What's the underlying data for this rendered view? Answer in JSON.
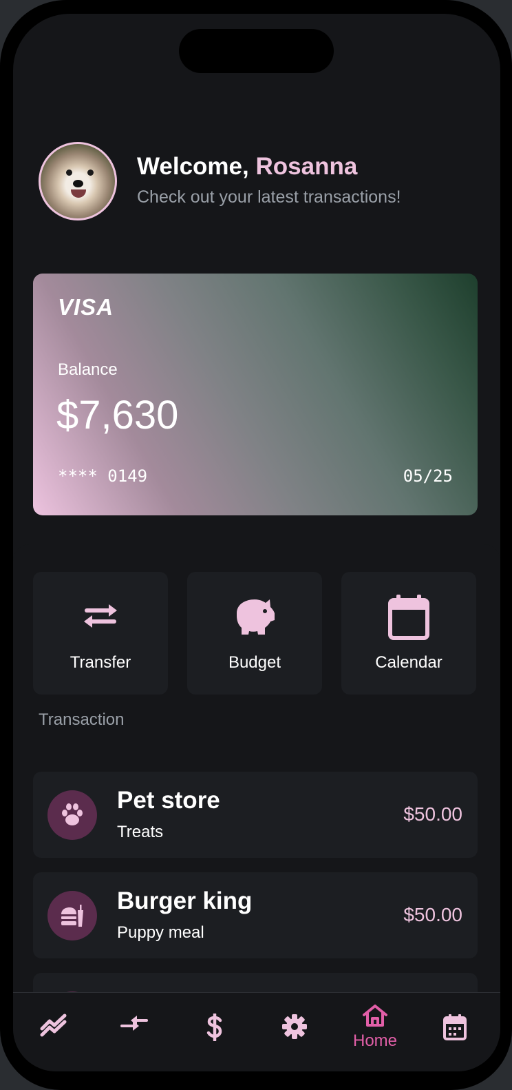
{
  "header": {
    "greeting": "Welcome, ",
    "user_name": "Rosanna",
    "subtitle": "Check out your latest transactions!"
  },
  "card": {
    "brand": "VISA",
    "balance_label": "Balance",
    "balance": "$7,630",
    "number": "**** 0149",
    "expiry": "05/25"
  },
  "actions": [
    {
      "label": "Transfer",
      "icon": "transfer-icon"
    },
    {
      "label": "Budget",
      "icon": "piggy-bank-icon"
    },
    {
      "label": "Calendar",
      "icon": "calendar-icon"
    }
  ],
  "transactions_section": {
    "title": "Transaction"
  },
  "transactions": [
    {
      "title": "Pet store",
      "subtitle": "Treats",
      "amount": "$50.00",
      "icon": "paw-icon"
    },
    {
      "title": "Burger king",
      "subtitle": "Puppy meal",
      "amount": "$50.00",
      "icon": "burger-icon"
    }
  ],
  "navbar": {
    "items": [
      {
        "icon": "chart-icon"
      },
      {
        "icon": "transfer-icon"
      },
      {
        "icon": "dollar-icon"
      },
      {
        "icon": "gear-icon"
      },
      {
        "icon": "home-icon",
        "label": "Home",
        "active": true
      },
      {
        "icon": "calendar-icon"
      }
    ]
  },
  "colors": {
    "accent": "#eec3de",
    "active_nav": "#e25fa8",
    "background": "#151619",
    "tile": "#1c1e22",
    "icon_circle": "#5b2c4d"
  }
}
